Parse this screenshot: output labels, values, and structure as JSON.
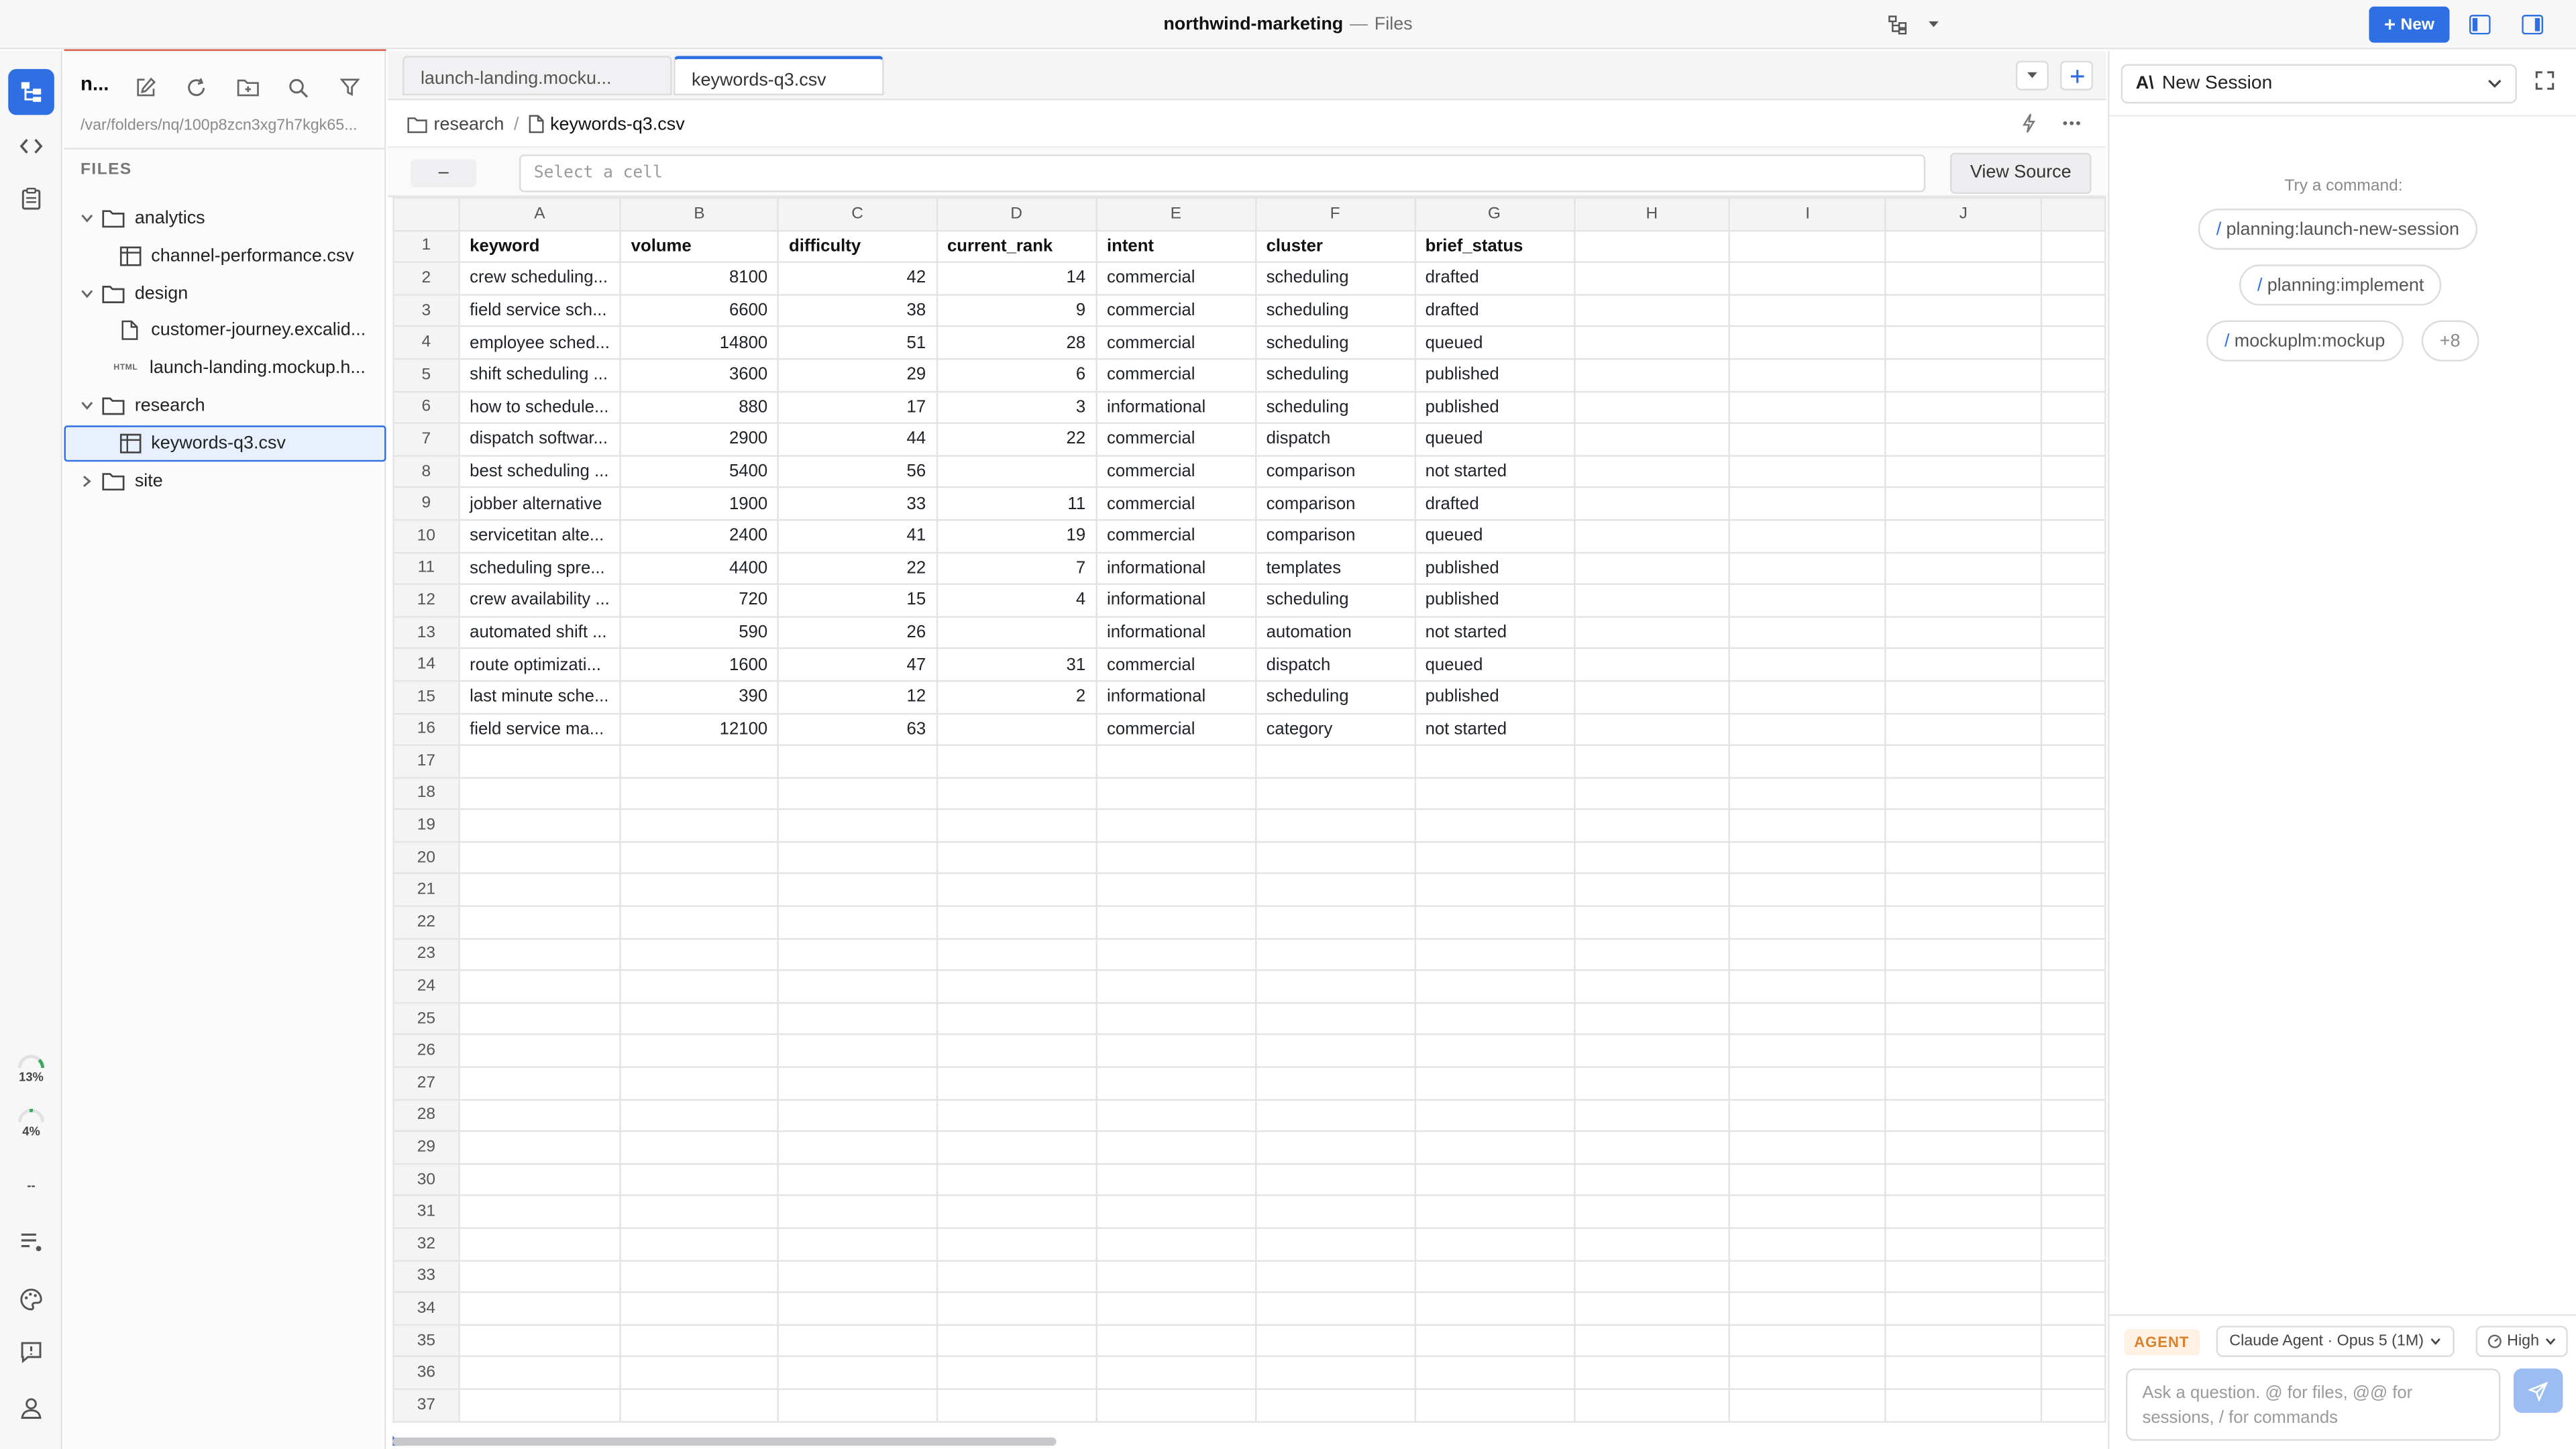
{
  "window": {
    "project": "northwind-marketing",
    "separator": "—",
    "section": "Files",
    "new_button": "New"
  },
  "rail": {
    "stats": [
      "13%",
      "4%",
      "--"
    ]
  },
  "files": {
    "workspace_abbrev": "n...",
    "path": "/var/folders/nq/100p8zcn3xg7h7kgk65...",
    "header": "FILES",
    "tree": [
      {
        "label": "analytics",
        "type": "folder",
        "expanded": true,
        "depth": 0
      },
      {
        "label": "channel-performance.csv",
        "type": "csv",
        "depth": 1
      },
      {
        "label": "design",
        "type": "folder",
        "expanded": true,
        "depth": 0
      },
      {
        "label": "customer-journey.excalid...",
        "type": "file",
        "depth": 1
      },
      {
        "label": "launch-landing.mockup.h...",
        "type": "html",
        "depth": 1
      },
      {
        "label": "research",
        "type": "folder",
        "expanded": true,
        "depth": 0
      },
      {
        "label": "keywords-q3.csv",
        "type": "csv",
        "depth": 1,
        "selected": true
      },
      {
        "label": "site",
        "type": "folder",
        "expanded": false,
        "depth": 0
      }
    ],
    "html_tag": "HTML"
  },
  "tabs": [
    {
      "label": "launch-landing.mocku...",
      "active": false
    },
    {
      "label": "keywords-q3.csv",
      "active": true
    }
  ],
  "breadcrumb": {
    "folder": "research",
    "file": "keywords-q3.csv"
  },
  "formula_bar": {
    "address": "–",
    "placeholder": "Select a cell",
    "view_source": "View Source"
  },
  "sheet": {
    "columns": [
      "A",
      "B",
      "C",
      "D",
      "E",
      "F",
      "G",
      "H",
      "I",
      "J"
    ],
    "headers": [
      "keyword",
      "volume",
      "difficulty",
      "current_rank",
      "intent",
      "cluster",
      "brief_status"
    ],
    "rows": [
      [
        "crew scheduling...",
        "8100",
        "42",
        "14",
        "commercial",
        "scheduling",
        "drafted"
      ],
      [
        "field service sch...",
        "6600",
        "38",
        "9",
        "commercial",
        "scheduling",
        "drafted"
      ],
      [
        "employee sched...",
        "14800",
        "51",
        "28",
        "commercial",
        "scheduling",
        "queued"
      ],
      [
        "shift scheduling ...",
        "3600",
        "29",
        "6",
        "commercial",
        "scheduling",
        "published"
      ],
      [
        "how to schedule...",
        "880",
        "17",
        "3",
        "informational",
        "scheduling",
        "published"
      ],
      [
        "dispatch softwar...",
        "2900",
        "44",
        "22",
        "commercial",
        "dispatch",
        "queued"
      ],
      [
        "best scheduling ...",
        "5400",
        "56",
        "",
        "commercial",
        "comparison",
        "not started"
      ],
      [
        "jobber alternative",
        "1900",
        "33",
        "11",
        "commercial",
        "comparison",
        "drafted"
      ],
      [
        "servicetitan alte...",
        "2400",
        "41",
        "19",
        "commercial",
        "comparison",
        "queued"
      ],
      [
        "scheduling spre...",
        "4400",
        "22",
        "7",
        "informational",
        "templates",
        "published"
      ],
      [
        "crew availability ...",
        "720",
        "15",
        "4",
        "informational",
        "scheduling",
        "published"
      ],
      [
        "automated shift ...",
        "590",
        "26",
        "",
        "informational",
        "automation",
        "not started"
      ],
      [
        "route optimizati...",
        "1600",
        "47",
        "31",
        "commercial",
        "dispatch",
        "queued"
      ],
      [
        "last minute sche...",
        "390",
        "12",
        "2",
        "informational",
        "scheduling",
        "published"
      ],
      [
        "field service ma...",
        "12100",
        "63",
        "",
        "commercial",
        "category",
        "not started"
      ]
    ],
    "total_rows": 37
  },
  "agent": {
    "session": "New Session",
    "try_label": "Try a command:",
    "commands": [
      "planning:launch-new-session",
      "planning:implement",
      "mockuplm:mockup"
    ],
    "more": "+8",
    "badge": "AGENT",
    "model": "Claude Agent · Opus 5 (1M)",
    "effort": "High",
    "input_placeholder": "Ask a question. @ for files, @@ for sessions, / for commands"
  }
}
